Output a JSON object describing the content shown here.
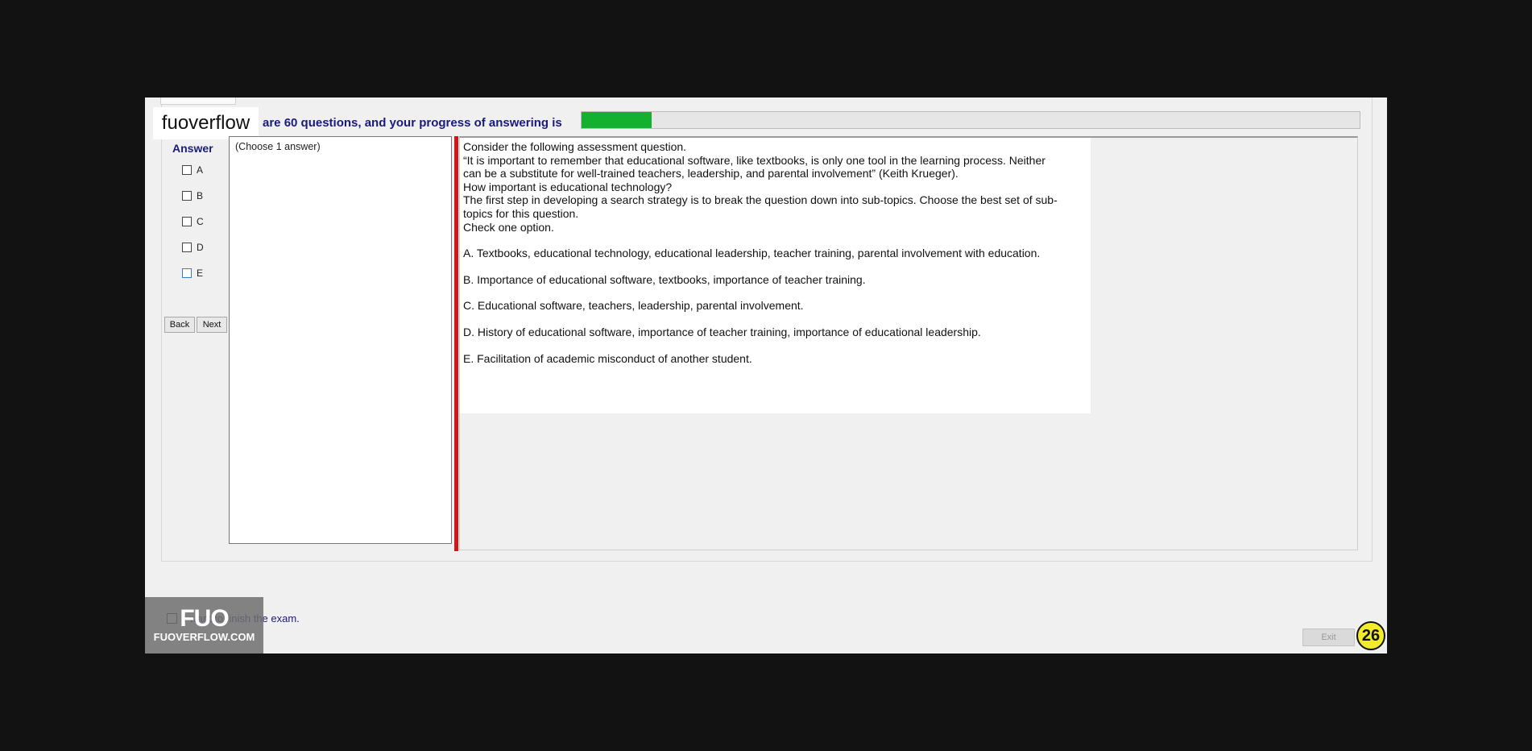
{
  "brand": {
    "top_logo": "fuoverflow",
    "bottom_logo_big": "FUO",
    "bottom_logo_small": "FUOVERFLOW.COM"
  },
  "progress": {
    "text": "are 60 questions, and your progress of answering is",
    "fraction": 0.0896,
    "fill_color": "#14b030"
  },
  "answer_panel": {
    "title": "Answer",
    "options": [
      "A",
      "B",
      "C",
      "D",
      "E"
    ],
    "back_label": "Back",
    "next_label": "Next"
  },
  "choose_label": "(Choose 1 answer)",
  "question": {
    "lines": [
      "Consider the following assessment question.",
      "“It is important to remember that educational software, like textbooks, is only one tool in the learning process. Neither can be a substitute for well-trained teachers, leadership, and parental involvement” (Keith Krueger).",
      "How important is educational technology?",
      "The first step in developing a search strategy is to break the question down into sub-topics. Choose the best set of sub-topics for this question.",
      "Check one option."
    ],
    "options": [
      "A.  Textbooks, educational technology, educational leadership, teacher training, parental involvement with education.",
      "B.  Importance of educational software, textbooks, importance of teacher training.",
      "C.  Educational software, teachers, leadership, parental involvement.",
      "D.  History of educational software, importance of teacher training, importance of educational leadership.",
      "E.  Facilitation of academic misconduct of another student."
    ]
  },
  "footer": {
    "finish_label": "I want to finish the exam.",
    "exit_label": "Exit",
    "badge_number": "26"
  },
  "colors": {
    "accent_text": "#1a1a7a",
    "separator": "#d0181b",
    "badge": "#f3ec2a"
  }
}
